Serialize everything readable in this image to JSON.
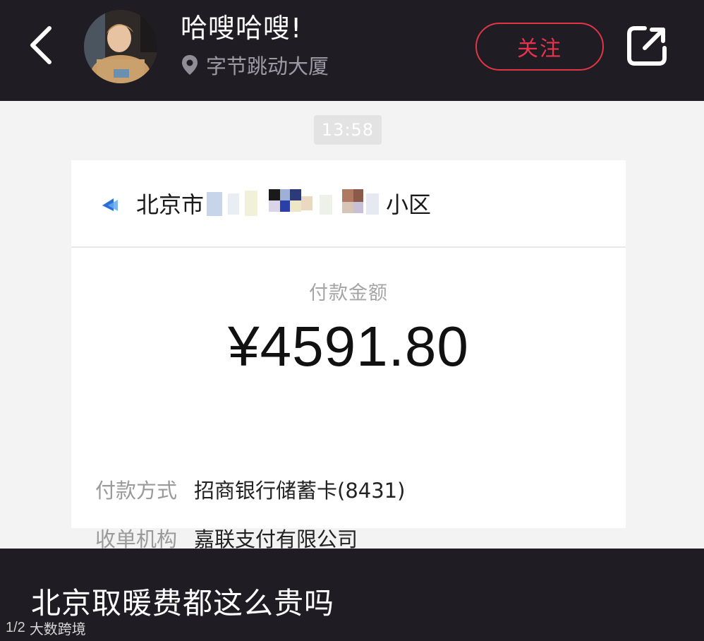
{
  "header": {
    "username": "哈嗖哈嗖!",
    "location": "字节跳动大厦",
    "follow_label": "关注"
  },
  "icons": {
    "back": "chevron-left-icon",
    "location": "map-pin-icon",
    "share": "share-external-icon",
    "merchant": "merchant-logo-icon"
  },
  "chat": {
    "time": "13:58"
  },
  "receipt": {
    "merchant_prefix": "北京市",
    "merchant_suffix": "小区",
    "amount_label": "付款金额",
    "amount": "¥4591.80",
    "rows": [
      {
        "key": "付款方式",
        "value": "招商银行储蓄卡(8431)"
      },
      {
        "key": "收单机构",
        "value": "嘉联支付有限公司"
      }
    ]
  },
  "footer": {
    "caption": "北京取暖费都这么贵吗",
    "watermark_logo": "1/2",
    "watermark_text": "大数跨境"
  },
  "colors": {
    "topbar_bg": "#1f1c24",
    "follow_red": "#e8334a",
    "content_bg": "#f3f3f3"
  }
}
